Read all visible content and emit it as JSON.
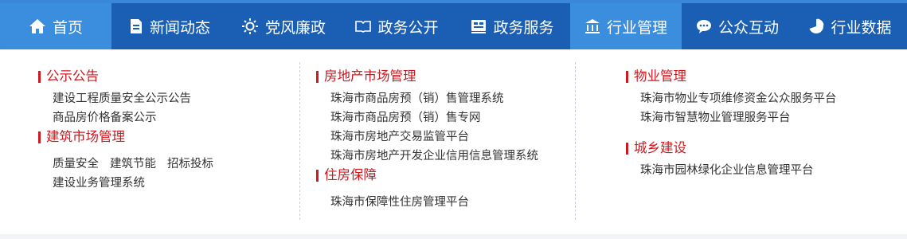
{
  "nav": {
    "items": [
      {
        "label": "首页",
        "icon": "home-icon"
      },
      {
        "label": "新闻动态",
        "icon": "document-icon"
      },
      {
        "label": "党风廉政",
        "icon": "sun-icon"
      },
      {
        "label": "政务公开",
        "icon": "book-icon"
      },
      {
        "label": "政务服务",
        "icon": "service-icon"
      },
      {
        "label": "行业管理",
        "icon": "bank-icon"
      },
      {
        "label": "公众互动",
        "icon": "chat-icon"
      },
      {
        "label": "行业数据",
        "icon": "pie-chart-icon"
      }
    ],
    "active": "行业管理",
    "colors": {
      "bar": "#1a5fb4",
      "active": "#3b8ede",
      "accent": "#d0181f"
    }
  },
  "menu": {
    "col1": {
      "public_notice": {
        "title": "公示公告",
        "links": [
          "建设工程质量安全公示公告",
          "商品房价格备案公示"
        ]
      },
      "construction_market": {
        "title": "建筑市场管理",
        "row_links": [
          "质量安全",
          "建筑节能",
          "招标投标"
        ],
        "links": [
          "建设业务管理系统"
        ]
      }
    },
    "col2": {
      "real_estate": {
        "title": "房地产市场管理",
        "links": [
          "珠海市商品房预（销）售管理系统",
          "珠海市商品房预（销）售专网",
          "珠海市房地产交易监管平台",
          "珠海市房地产开发企业信用信息管理系统"
        ]
      },
      "housing": {
        "title": "住房保障",
        "links": [
          "珠海市保障性住房管理平台"
        ]
      }
    },
    "col3": {
      "property": {
        "title": "物业管理",
        "links": [
          "珠海市物业专项维修资金公众服务平台",
          "珠海市智慧物业管理服务平台"
        ]
      },
      "urban_rural": {
        "title": "城乡建设",
        "links": [
          "珠海市园林绿化企业信息管理平台"
        ]
      }
    }
  }
}
